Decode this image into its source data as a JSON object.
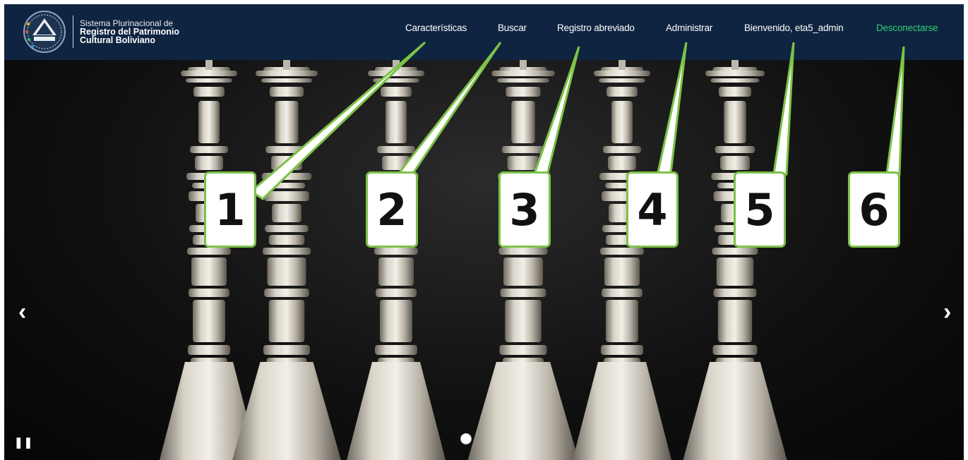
{
  "brand": {
    "line1": "Sistema Plurinacional de",
    "line2": "Registro del Patrimonio",
    "line3": "Cultural Boliviano",
    "logo_icon": "emblem-icon"
  },
  "nav": {
    "items": [
      {
        "label": "Características"
      },
      {
        "label": "Buscar"
      },
      {
        "label": "Registro abreviado"
      },
      {
        "label": "Administrar"
      },
      {
        "label": "Bienvenido, eta5_admin"
      },
      {
        "label": "Desconectarse"
      }
    ]
  },
  "carousel": {
    "prev_icon": "chevron-left-icon",
    "next_icon": "chevron-right-icon",
    "pause_icon": "pause-icon",
    "prev_glyph": "‹",
    "next_glyph": "›",
    "pause_glyph": "❚❚",
    "image_description": "silver candlesticks"
  },
  "callouts": [
    "1",
    "2",
    "3",
    "4",
    "5",
    "6"
  ],
  "colors": {
    "topbar": "#0f2440",
    "logout": "#2ecc71",
    "callout_border": "#7cc248"
  }
}
